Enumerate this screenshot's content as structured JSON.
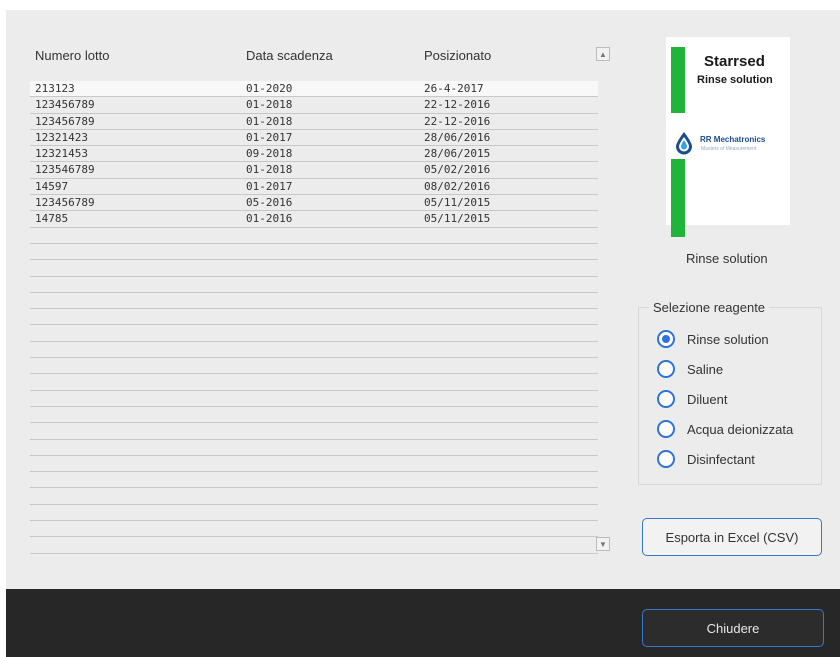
{
  "table": {
    "headers": [
      "Numero lotto",
      "Data scadenza",
      "Posizionato"
    ],
    "rows": [
      [
        "213123",
        "01-2020",
        "26-4-2017"
      ],
      [
        "123456789",
        "01-2018",
        "22-12-2016"
      ],
      [
        "123456789",
        "01-2018",
        "22-12-2016"
      ],
      [
        "12321423",
        "01-2017",
        "28/06/2016"
      ],
      [
        "12321453",
        "09-2018",
        "28/06/2015"
      ],
      [
        "123546789",
        "01-2018",
        "05/02/2016"
      ],
      [
        "14597",
        "01-2017",
        "08/02/2016"
      ],
      [
        "123456789",
        "05-2016",
        "05/11/2015"
      ],
      [
        "14785",
        "01-2016",
        "05/11/2015"
      ]
    ],
    "scroll_up_icon": "▲",
    "scroll_down_icon": "▼"
  },
  "logo": {
    "title": "Starrsed",
    "subtitle": "Rinse solution",
    "brand": "RR Mechatronics",
    "tagline": "Masters of Measurement",
    "accent_color": "#21b43a",
    "brand_color": "#1b4d8f"
  },
  "product_label": "Rinse solution",
  "reagent_group": {
    "legend": "Selezione reagente",
    "options": [
      "Rinse solution",
      "Saline",
      "Diluent",
      "Acqua deionizzata",
      "Disinfectant"
    ],
    "selected": "Rinse solution"
  },
  "buttons": {
    "export": "Esporta in Excel (CSV)",
    "close": "Chiudere"
  }
}
